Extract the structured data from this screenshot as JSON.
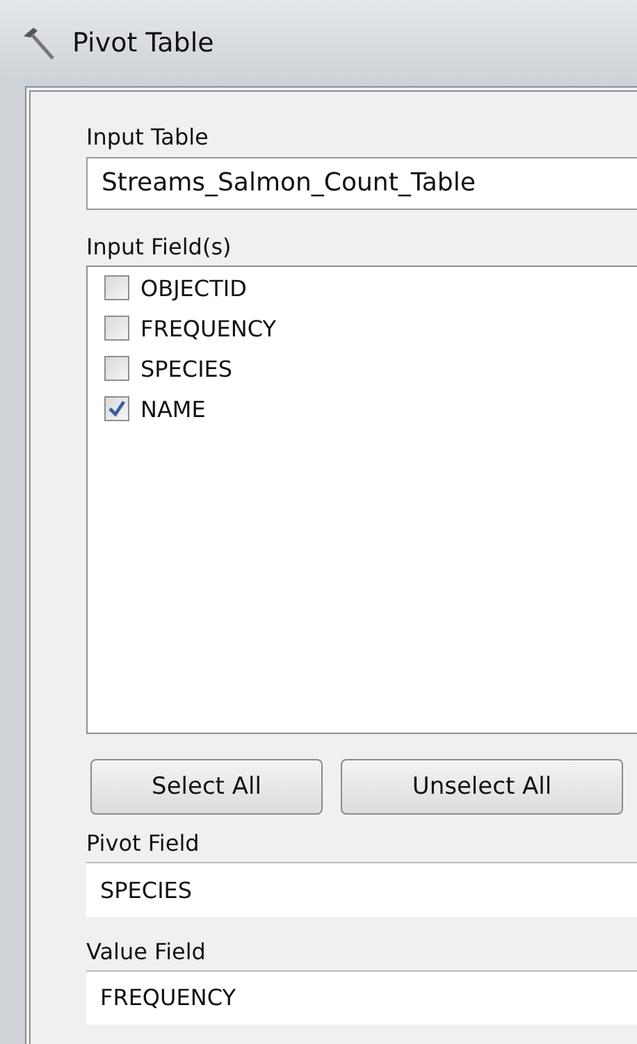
{
  "window": {
    "title": "Pivot Table"
  },
  "input_table": {
    "label": "Input Table",
    "value": "Streams_Salmon_Count_Table"
  },
  "input_fields": {
    "label": "Input Field(s)",
    "items": [
      {
        "label": "OBJECTID",
        "checked": false
      },
      {
        "label": "FREQUENCY",
        "checked": false
      },
      {
        "label": "SPECIES",
        "checked": false
      },
      {
        "label": "NAME",
        "checked": true
      }
    ]
  },
  "buttons": [
    "Select All",
    "Unselect All"
  ],
  "pivot_field": {
    "label": "Pivot Field",
    "value": "SPECIES"
  },
  "value_field": {
    "label": "Value Field",
    "value": "FREQUENCY"
  }
}
